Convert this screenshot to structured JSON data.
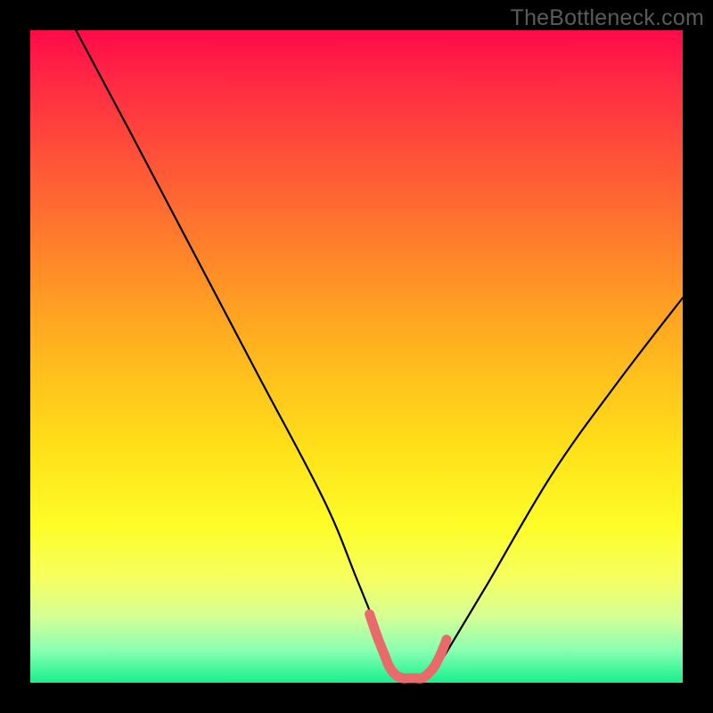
{
  "watermark": "TheBottleneck.com",
  "chart_data": {
    "type": "line",
    "title": "",
    "xlabel": "",
    "ylabel": "",
    "xlim": [
      0,
      100
    ],
    "ylim": [
      0,
      100
    ],
    "grid": false,
    "legend": false,
    "series": [
      {
        "name": "bottleneck-curve",
        "color": "#000000",
        "x": [
          7,
          15,
          25,
          35,
          45,
          50,
          54,
          55,
          57,
          60,
          62,
          64,
          70,
          80,
          90,
          100
        ],
        "y": [
          100,
          85,
          66,
          47,
          28,
          16,
          6,
          3,
          0.8,
          0.8,
          2,
          5,
          15,
          32,
          46,
          59
        ]
      },
      {
        "name": "optimal-zone-marker",
        "color": "#e86a6a",
        "x": [
          52.0,
          53.2,
          54.2,
          55.0,
          56.0,
          57.0,
          58.0,
          59.0,
          60.0,
          61.0,
          62.0,
          63.0,
          63.8
        ],
        "y": [
          10.5,
          7.0,
          4.5,
          2.5,
          1.2,
          0.7,
          0.7,
          0.7,
          0.7,
          1.4,
          2.6,
          4.6,
          6.6
        ]
      }
    ],
    "gradient_stops": [
      {
        "pos": 0.0,
        "color": "#ff0a4a"
      },
      {
        "pos": 0.08,
        "color": "#ff2a43"
      },
      {
        "pos": 0.22,
        "color": "#ff5a36"
      },
      {
        "pos": 0.36,
        "color": "#ff8a28"
      },
      {
        "pos": 0.5,
        "color": "#ffb81e"
      },
      {
        "pos": 0.64,
        "color": "#ffe019"
      },
      {
        "pos": 0.76,
        "color": "#fdfd28"
      },
      {
        "pos": 0.84,
        "color": "#f6ff60"
      },
      {
        "pos": 0.9,
        "color": "#d4ff96"
      },
      {
        "pos": 0.95,
        "color": "#8affb2"
      },
      {
        "pos": 1.0,
        "color": "#18f08c"
      }
    ]
  }
}
